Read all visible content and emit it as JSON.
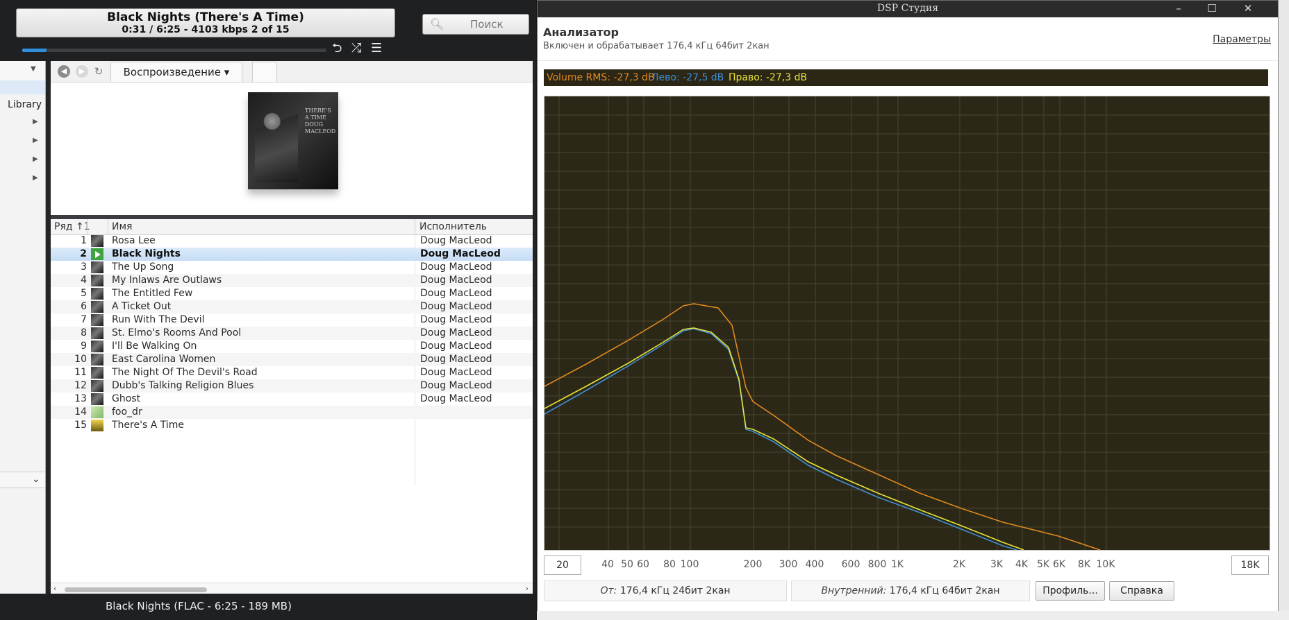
{
  "player": {
    "now_playing": {
      "title": "Black Nights (There's A Time)",
      "status": "0:31 / 6:25 - 4103 kbps  2 of 15",
      "progress": 0.08
    },
    "search": {
      "placeholder": "Поиск"
    },
    "controls": {
      "repeat_icon": "⮌",
      "shuffle_icon": "⤮",
      "eq_icon": "☰"
    },
    "sidebar": {
      "library_label": "Library"
    },
    "toolbar": {
      "view_label": "Воспроизведение ▾"
    },
    "album": {
      "cover_text": "THERE'S A TIME\nDOUG MACLEOD"
    },
    "list": {
      "headers": {
        "row": "Ряд ↑1",
        "name": "Имя",
        "artist": "Исполнитель"
      },
      "rows": [
        {
          "num": "1",
          "name": "Rosa Lee",
          "artist": "Doug MacLeod"
        },
        {
          "num": "2",
          "name": "Black Nights",
          "artist": "Doug MacLeod"
        },
        {
          "num": "3",
          "name": "The Up Song",
          "artist": "Doug MacLeod"
        },
        {
          "num": "4",
          "name": "My Inlaws Are Outlaws",
          "artist": "Doug MacLeod"
        },
        {
          "num": "5",
          "name": "The Entitled Few",
          "artist": "Doug MacLeod"
        },
        {
          "num": "6",
          "name": "A Ticket Out",
          "artist": "Doug MacLeod"
        },
        {
          "num": "7",
          "name": "Run With The Devil",
          "artist": "Doug MacLeod"
        },
        {
          "num": "8",
          "name": "St. Elmo's Rooms And Pool",
          "artist": "Doug MacLeod"
        },
        {
          "num": "9",
          "name": "I'll Be Walking On",
          "artist": "Doug MacLeod"
        },
        {
          "num": "10",
          "name": "East Carolina Women",
          "artist": "Doug MacLeod"
        },
        {
          "num": "11",
          "name": "The Night Of The Devil's Road",
          "artist": "Doug MacLeod"
        },
        {
          "num": "12",
          "name": "Dubb's Talking Religion Blues",
          "artist": "Doug MacLeod"
        },
        {
          "num": "13",
          "name": "Ghost",
          "artist": "Doug MacLeod"
        },
        {
          "num": "14",
          "name": "foo_dr",
          "artist": ""
        },
        {
          "num": "15",
          "name": "There's A Time",
          "artist": ""
        }
      ]
    },
    "status_bar": "Black Nights (FLAC - 6:25 - 189 MB)"
  },
  "dsp": {
    "window_title": "DSP Студия",
    "analyzer_title": "Анализатор",
    "analyzer_subtitle": "Включен и обрабатывает 176,4 кГц 64бит 2кан",
    "params_link": "Параметры",
    "meter": {
      "rms": "Volume RMS: -27,3 dB",
      "left": "Лево: -27,5 dB",
      "right": "Право: -27,3 dB",
      "rms_color": "#e08a1e",
      "left_color": "#3e8fd4",
      "right_color": "#e6e43a"
    },
    "freq_min": "20",
    "freq_max": "18K",
    "freq_ticks": [
      "40",
      "50",
      "60",
      "80",
      "100",
      "200",
      "300",
      "400",
      "600",
      "800",
      "1K",
      "2K",
      "3K",
      "4K",
      "5K",
      "6K",
      "8K",
      "10K"
    ],
    "from_label": "От:",
    "from_value": " 176,4 кГц 24бит 2кан",
    "internal_label": "Внутренний:",
    "internal_value": " 176,4 кГц 64бит 2кан",
    "profile_button": "Профиль...",
    "help_button": "Справка"
  }
}
